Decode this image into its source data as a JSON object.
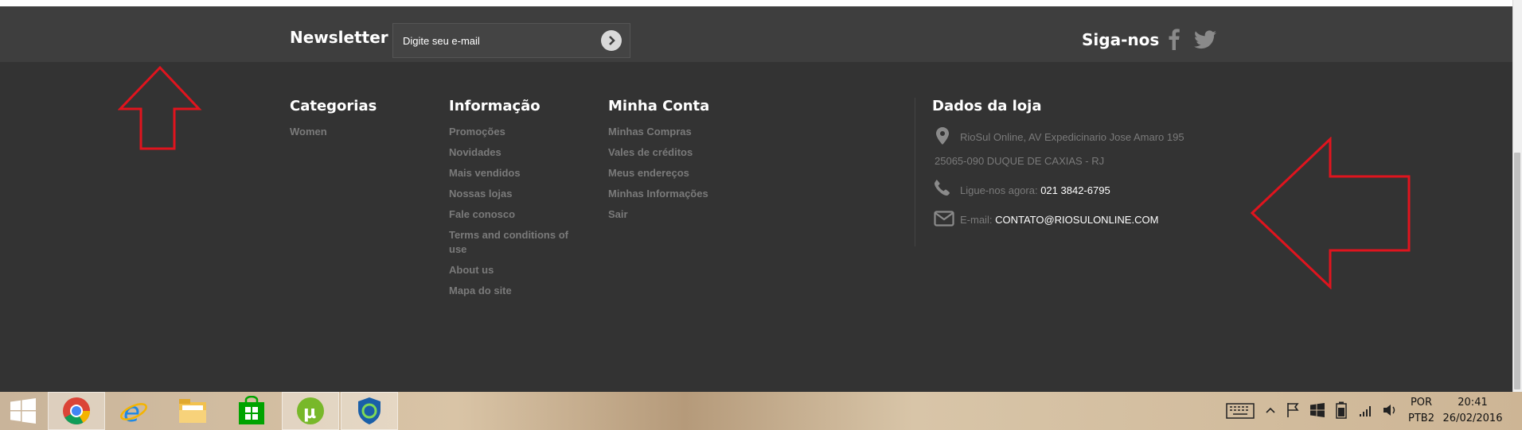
{
  "newsletter": {
    "title": "Newsletter",
    "email_placeholder": "Digite seu e-mail",
    "submit_icon": "arrow-right-circle-icon"
  },
  "social": {
    "title": "Siga-nos",
    "icons": [
      "facebook-icon",
      "twitter-icon"
    ]
  },
  "columns": {
    "categorias": {
      "title": "Categorias",
      "links": [
        "Women"
      ]
    },
    "informacao": {
      "title": "Informação",
      "links": [
        "Promoções",
        "Novidades",
        "Mais vendidos",
        "Nossas lojas",
        "Fale conosco",
        "Terms and conditions of use",
        "About us",
        "Mapa do site"
      ]
    },
    "minha_conta": {
      "title": "Minha Conta",
      "links": [
        "Minhas Compras",
        "Vales de créditos",
        "Meus endereços",
        "Minhas Informações",
        "Sair"
      ]
    }
  },
  "store": {
    "title": "Dados da loja",
    "address_line1": "RioSul Online, AV Expedicinario Jose Amaro 195",
    "address_line2": "25065-090 DUQUE DE CAXIAS - RJ",
    "phone_label": "Ligue-nos agora:",
    "phone": "021 3842-6795",
    "email_label": "E-mail:",
    "email": "CONTATO@RIOSULONLINE.COM"
  },
  "annotations": {
    "color": "#e0141e",
    "shapes": [
      "up-arrow",
      "left-arrow"
    ]
  },
  "taskbar": {
    "apps": [
      "windows-start",
      "chrome",
      "internet-explorer",
      "file-explorer",
      "windows-store",
      "utorrent",
      "vpn-shield"
    ],
    "lang_top": "POR",
    "lang_bottom": "PTB2",
    "time": "20:41",
    "date": "26/02/2016"
  }
}
